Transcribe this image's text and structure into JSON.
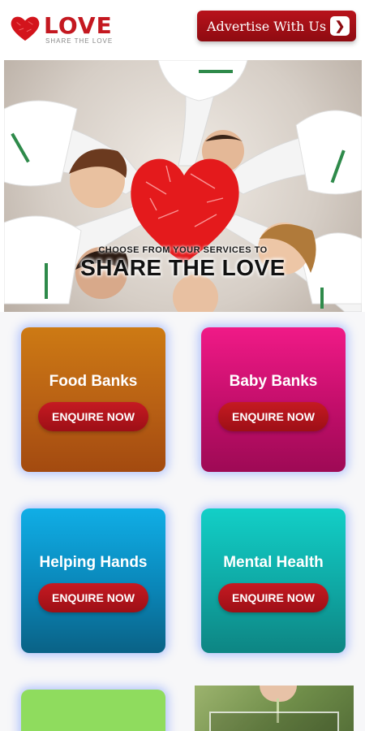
{
  "header": {
    "logo_word": "LOVE",
    "logo_tagline": "SHARE THE LOVE",
    "advertise_label": "Advertise With Us",
    "advertise_icon": "chevron-right-icon"
  },
  "hero": {
    "subtitle": "CHOOSE FROM YOUR SERVICES TO",
    "title": "SHARE THE LOVE"
  },
  "services": [
    {
      "title": "Food Banks",
      "button": "ENQUIRE NOW"
    },
    {
      "title": "Baby Banks",
      "button": "ENQUIRE NOW"
    },
    {
      "title": "Helping Hands",
      "button": "ENQUIRE NOW"
    },
    {
      "title": "Mental Health",
      "button": "ENQUIRE NOW"
    }
  ],
  "colors": {
    "brand_red": "#c41820",
    "food": "#b86014",
    "baby": "#c20e6a",
    "help": "#0a86b8",
    "mental": "#0fa8a4",
    "card_glow": "#5a82ff"
  }
}
